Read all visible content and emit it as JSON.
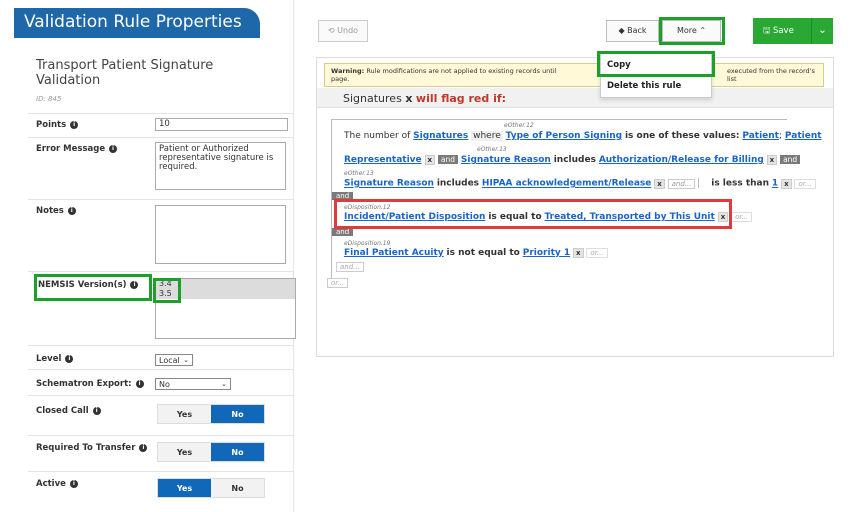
{
  "header": {
    "title": "Validation Rule Properties"
  },
  "rule": {
    "name": "Transport Patient Signature Validation",
    "id": "ID: 845"
  },
  "props": {
    "points": {
      "label": "Points",
      "value": "10"
    },
    "error_message": {
      "label": "Error Message",
      "value": "Patient or Authorized representative signature is required."
    },
    "notes": {
      "label": "Notes",
      "value": ""
    },
    "nemsis": {
      "label": "NEMSIS Version(s)",
      "options": [
        "3.4",
        "3.5"
      ]
    },
    "level": {
      "label": "Level",
      "value": "Local"
    },
    "schematron": {
      "label": "Schematron Export:",
      "value": "No"
    },
    "closed_call": {
      "label": "Closed Call",
      "yes": "Yes",
      "no": "No",
      "selected": "No"
    },
    "required_transfer": {
      "label": "Required To Transfer",
      "yes": "Yes",
      "no": "No",
      "selected": "No"
    },
    "active": {
      "label": "Active",
      "yes": "Yes",
      "no": "No",
      "selected": "Yes"
    }
  },
  "toolbar": {
    "undo": "⟲ Undo",
    "back": "◆ Back",
    "more": "More ⌃",
    "save": "🖫 Save",
    "save_dd": "⌄"
  },
  "dropdown": {
    "copy": "Copy",
    "delete": "Delete this rule"
  },
  "warning": {
    "bold": "Warning:",
    "text1": " Rule modifications are not applied to existing records until",
    "text2": "executed from the record's list",
    "text3": "page."
  },
  "subheader": {
    "field": "Signatures",
    "x": "x",
    "red": "will flag red if:"
  },
  "rule_logic": {
    "l1_code": "eOther.12",
    "l1_prefix": "The number of ",
    "l1_field": "Signatures",
    "l1_where": "where",
    "l1_field2": "Type of Person Signing",
    "l1_op": "is one of these values:",
    "l1_v1": "Patient",
    "l1_sep": ";",
    "l1_v2": "Patient",
    "l2_code": "eOther.13",
    "l2_v": "Representative",
    "l2_x": "x",
    "l2_and": "and",
    "l2_field": "Signature Reason",
    "l2_op": "includes",
    "l2_val": "Authorization/Release for Billing",
    "l2_x2": "x",
    "l2_and2": "and",
    "l3_code": "eOther.13",
    "l3_field": "Signature Reason",
    "l3_op": "includes",
    "l3_val": "HIPAA acknowledgement/Release",
    "l3_x": "x",
    "l3_andplus": "and...",
    "l3_cmp": "is less than",
    "l3_num": "1",
    "l3_x2": "x",
    "l3_or": "or...",
    "and_tag": "and",
    "l4_code": "eDisposition.12",
    "l4_field": "Incident/Patient Disposition",
    "l4_op": "is equal to",
    "l4_val": "Treated, Transported by This Unit",
    "l4_x": "x",
    "l4_or": "or...",
    "and_tag2": "and",
    "l5_code": "eDisposition.19",
    "l5_field": "Final Patient Acuity",
    "l5_op": "is not equal to",
    "l5_val": "Priority 1",
    "l5_x": "x",
    "l5_or": "or...",
    "and_more": "and...",
    "or_more": "or..."
  }
}
